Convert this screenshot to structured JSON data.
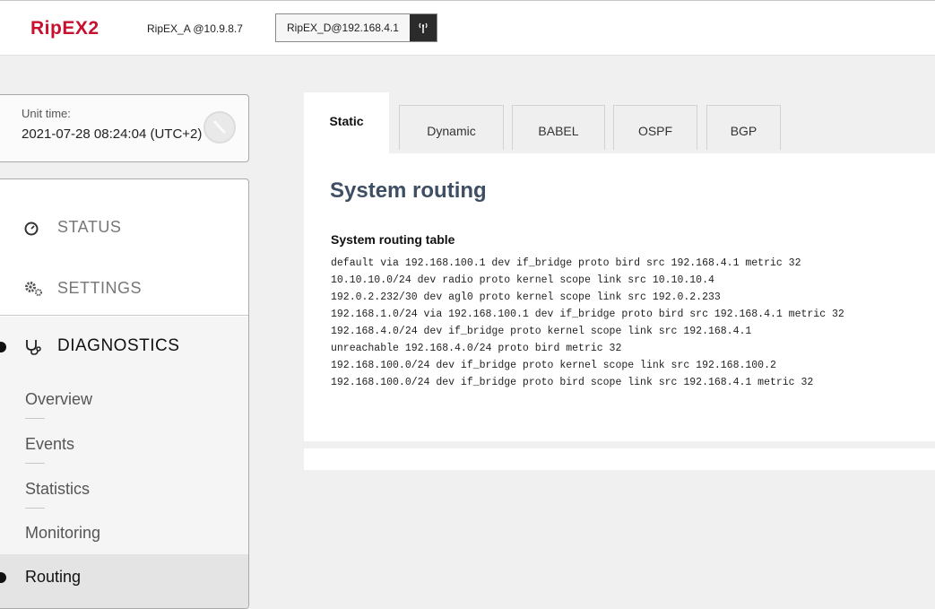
{
  "header": {
    "logo_text": "RipEX",
    "logo_suffix": "2",
    "local_unit": "RipEX_A @10.9.8.7",
    "remote_unit": "RipEX_D@192.168.4.1",
    "remote_unit_icon": "antenna-signal-icon",
    "brand_color": "#c8102e"
  },
  "unit_time": {
    "label": "Unit time:",
    "value": "2021-07-28 08:24:04 (UTC+2)",
    "icon": "clock-icon"
  },
  "menu": {
    "status": {
      "label": "STATUS",
      "icon": "gauge-icon"
    },
    "settings": {
      "label": "SETTINGS",
      "icon": "gears-icon"
    },
    "diagnostics": {
      "label": "DIAGNOSTICS",
      "icon": "stethoscope-icon"
    },
    "sub_items": [
      {
        "label": "Overview"
      },
      {
        "label": "Events"
      },
      {
        "label": "Statistics"
      },
      {
        "label": "Monitoring"
      },
      {
        "label": "Routing"
      }
    ],
    "active_item": "Routing"
  },
  "tabs": [
    {
      "label": "Static",
      "active": true
    },
    {
      "label": "Dynamic",
      "active": false
    },
    {
      "label": "BABEL",
      "active": false
    },
    {
      "label": "OSPF",
      "active": false
    },
    {
      "label": "BGP",
      "active": false
    }
  ],
  "main": {
    "title": "System routing",
    "table_title": "System routing table",
    "routes": [
      "default via 192.168.100.1 dev if_bridge proto bird src 192.168.4.1 metric 32",
      "10.10.10.0/24 dev radio proto kernel scope link src 10.10.10.4",
      "192.0.2.232/30 dev agl0 proto kernel scope link src 192.0.2.233",
      "192.168.1.0/24 via 192.168.100.1 dev if_bridge proto bird src 192.168.4.1 metric 32",
      "192.168.4.0/24 dev if_bridge proto kernel scope link src 192.168.4.1",
      "unreachable 192.168.4.0/24 proto bird metric 32",
      "192.168.100.0/24 dev if_bridge proto kernel scope link src 192.168.100.2",
      "192.168.100.0/24 dev if_bridge proto bird scope link src 192.168.4.1 metric 32"
    ]
  }
}
